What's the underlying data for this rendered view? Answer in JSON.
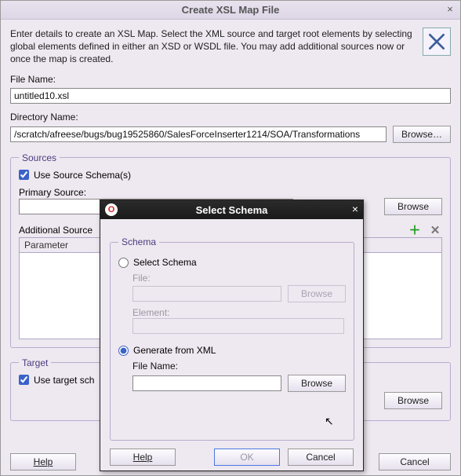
{
  "main": {
    "title": "Create XSL Map File",
    "intro": "Enter details to create an XSL Map. Select the XML source and target root elements by selecting global elements defined in either an XSD or WSDL file.  You may add additional sources now or once the map is created.",
    "file_name_label": "File Name:",
    "file_name_value": "untitled10.xsl",
    "directory_label": "Directory Name:",
    "directory_value": "/scratch/afreese/bugs/bug19525860/SalesForceInserter1214/SOA/Transformations",
    "browse_label": "Browse…",
    "sources": {
      "legend": "Sources",
      "use_source_label": "Use Source Schema(s)",
      "use_source_checked": true,
      "primary_label": "Primary Source:",
      "primary_value": "",
      "browse_label": "Browse",
      "additional_label": "Additional Source",
      "list_header": "Parameter"
    },
    "target": {
      "legend": "Target",
      "use_target_label": "Use target sch",
      "use_target_checked": true,
      "browse_label": "Browse"
    },
    "buttons": {
      "help": "Help",
      "cancel": "Cancel"
    }
  },
  "modal": {
    "title": "Select Schema",
    "schema_legend": "Schema",
    "opt_select_label": "Select Schema",
    "file_label": "File:",
    "browse_disabled_label": "Browse",
    "element_label": "Element:",
    "opt_generate_label": "Generate from XML",
    "filename_label": "File Name:",
    "filename_value": "",
    "browse_label": "Browse",
    "buttons": {
      "help": "Help",
      "ok": "OK",
      "cancel": "Cancel"
    }
  }
}
